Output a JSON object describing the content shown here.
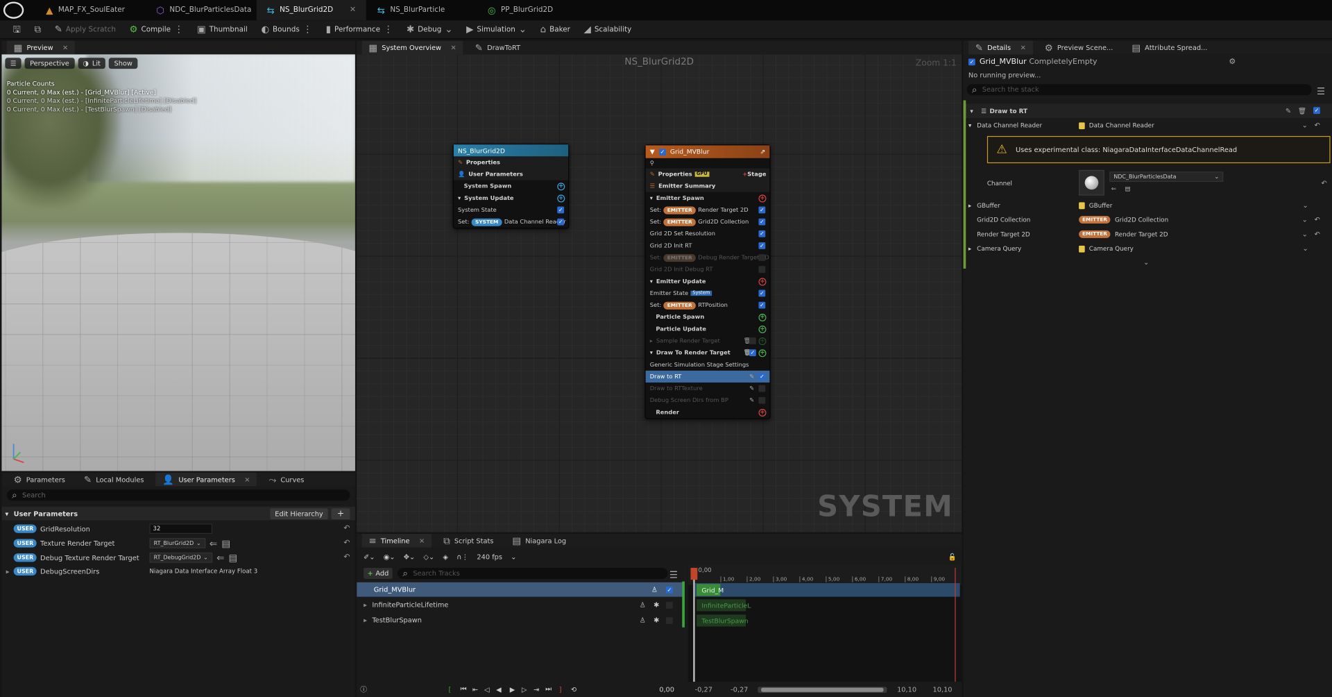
{
  "tabs": [
    {
      "label": "MAP_FX_SoulEater",
      "icon": "level-icon"
    },
    {
      "label": "NDC_BlurParticlesData",
      "icon": "data-channel-icon"
    },
    {
      "label": "NS_BlurGrid2D",
      "icon": "niagara-system-icon"
    },
    {
      "label": "NS_BlurParticle",
      "icon": "niagara-system-icon"
    },
    {
      "label": "PP_BlurGrid2D",
      "icon": "material-icon"
    }
  ],
  "toolbar": {
    "apply_scratch": "Apply Scratch",
    "compile": "Compile",
    "thumbnail": "Thumbnail",
    "bounds": "Bounds",
    "performance": "Performance",
    "debug": "Debug",
    "simulation": "Simulation",
    "baker": "Baker",
    "scalability": "Scalability"
  },
  "preview": {
    "tab": "Preview",
    "perspective": "Perspective",
    "lit": "Lit",
    "show": "Show",
    "stats_title": "Particle Counts",
    "stats": [
      "0 Current, 0 Max (est.) - [Grid_MVBlur] [Active]",
      "0 Current, 0 Max (est.) - [InfiniteParticleLifetime] [Disabled]",
      "0 Current, 0 Max (est.) - [TestBlurSpawn] [Disabled]"
    ]
  },
  "params": {
    "tabs": [
      "Parameters",
      "Local Modules",
      "User Parameters",
      "Curves"
    ],
    "search_placeholder": "Search",
    "group": "User Parameters",
    "edit_hierarchy": "Edit Hierarchy",
    "badge": "USER",
    "rows": [
      {
        "name": "GridResolution",
        "value": "32"
      },
      {
        "name": "Texture Render Target",
        "value": "RT_BlurGrid2D"
      },
      {
        "name": "Debug Texture Render Target",
        "value": "RT_DebugGrid2D"
      },
      {
        "name": "DebugScreenDirs",
        "value": "Niagara Data Interface Array Float 3"
      }
    ]
  },
  "graph": {
    "tabs": [
      "System Overview",
      "DrawToRT"
    ],
    "title": "NS_BlurGrid2D",
    "zoom": "Zoom 1:1",
    "watermark": "SYSTEM",
    "system_node": {
      "title": "NS_BlurGrid2D",
      "rows": [
        "Properties",
        "User Parameters",
        "System Spawn",
        "System Update",
        "System State",
        "Data Channel Reader"
      ],
      "set": "Set:",
      "system_badge": "SYSTEM"
    },
    "emitter_node": {
      "title": "Grid_MVBlur",
      "properties": "Properties",
      "properties_badge": "GPU",
      "stage": "Stage",
      "emitter_summary": "Emitter Summary",
      "emitter_spawn": "Emitter Spawn",
      "set": "Set:",
      "emitter_badge": "EMITTER",
      "spawn_rows": [
        "Render Target 2D",
        "Grid2D Collection"
      ],
      "grid_set_res": "Grid 2D Set Resolution",
      "grid_init_rt": "Grid 2D Init RT",
      "debug_rt": "Debug Render Target 2D",
      "grid_init_debug": "Grid 2D Init Debug RT",
      "emitter_update": "Emitter Update",
      "emitter_state": "Emitter State",
      "system_tag": "System",
      "rt_position": "RTPosition",
      "particle_spawn": "Particle Spawn",
      "particle_update": "Particle Update",
      "sample_rt": "Sample Render Target",
      "draw_to_rt": "Draw To Render Target",
      "generic_settings": "Generic Simulation Stage Settings",
      "draw_rt": "Draw to RT",
      "draw_rtexture": "Draw to RTTexture",
      "debug_screen": "Debug Screen Dirs from BP",
      "render": "Render"
    }
  },
  "details": {
    "tabs": [
      "Details",
      "Preview Scene...",
      "Attribute Spread..."
    ],
    "object_name": "Grid_MVBlur",
    "object_suffix": "CompletelyEmpty",
    "running": "No running preview...",
    "search_placeholder": "Search the stack",
    "section": "Draw to RT",
    "rows": {
      "dcr_label": "Data Channel Reader",
      "dcr_value": "Data Channel Reader",
      "warning": "Uses experimental class: NiagaraDataInterfaceDataChannelRead",
      "channel_label": "Channel",
      "channel_value": "NDC_BlurParticlesData",
      "gbuffer_label": "GBuffer",
      "gbuffer_value": "GBuffer",
      "grid_label": "Grid2D Collection",
      "grid_value": "Grid2D Collection",
      "rt_label": "Render Target 2D",
      "rt_value": "Render Target 2D",
      "cam_label": "Camera Query",
      "cam_value": "Camera Query",
      "emitter_badge": "EMITTER"
    }
  },
  "timeline": {
    "tabs": [
      "Timeline",
      "Script Stats",
      "Niagara Log"
    ],
    "fps": "240 fps",
    "add": "Add",
    "search_placeholder": "Search Tracks",
    "tracks": [
      "Grid_MVBlur",
      "InfiniteParticleLifetime",
      "TestBlurSpawn"
    ],
    "ruler_start": "0,00",
    "ticks": [
      "1,00",
      "2,00",
      "3,00",
      "4,00",
      "5,00",
      "6,00",
      "7,00",
      "8,00",
      "9,00"
    ],
    "clips": [
      "Grid_M",
      "InfiniteParticleL",
      "TestBlurSpawn"
    ],
    "time_value": "0,00",
    "range_start": "-0,27",
    "range_start2": "-0,27",
    "range_end": "10,10",
    "range_end2": "10,10"
  }
}
